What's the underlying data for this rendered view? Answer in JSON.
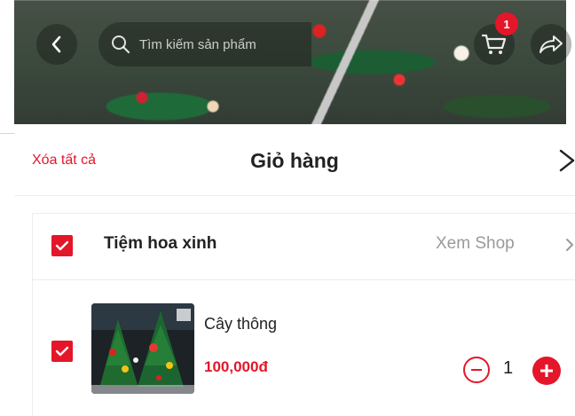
{
  "header": {
    "search_placeholder": "Tìm kiếm sản phẩm",
    "cart_count": "1"
  },
  "sheet": {
    "clear_all_label": "Xóa tất cả",
    "title": "Giỏ hàng"
  },
  "shop": {
    "name": "Tiệm hoa xinh",
    "view_shop_label": "Xem Shop",
    "items": [
      {
        "name": "Cây thông",
        "price": "100,000đ",
        "quantity": "1"
      }
    ]
  },
  "colors": {
    "accent": "#e4162a",
    "muted_text": "#9a9a9a"
  },
  "icons": [
    "back-icon",
    "search-icon",
    "cart-icon",
    "share-icon",
    "close-icon",
    "chevron-right-icon",
    "check-icon",
    "minus-icon",
    "plus-icon"
  ]
}
